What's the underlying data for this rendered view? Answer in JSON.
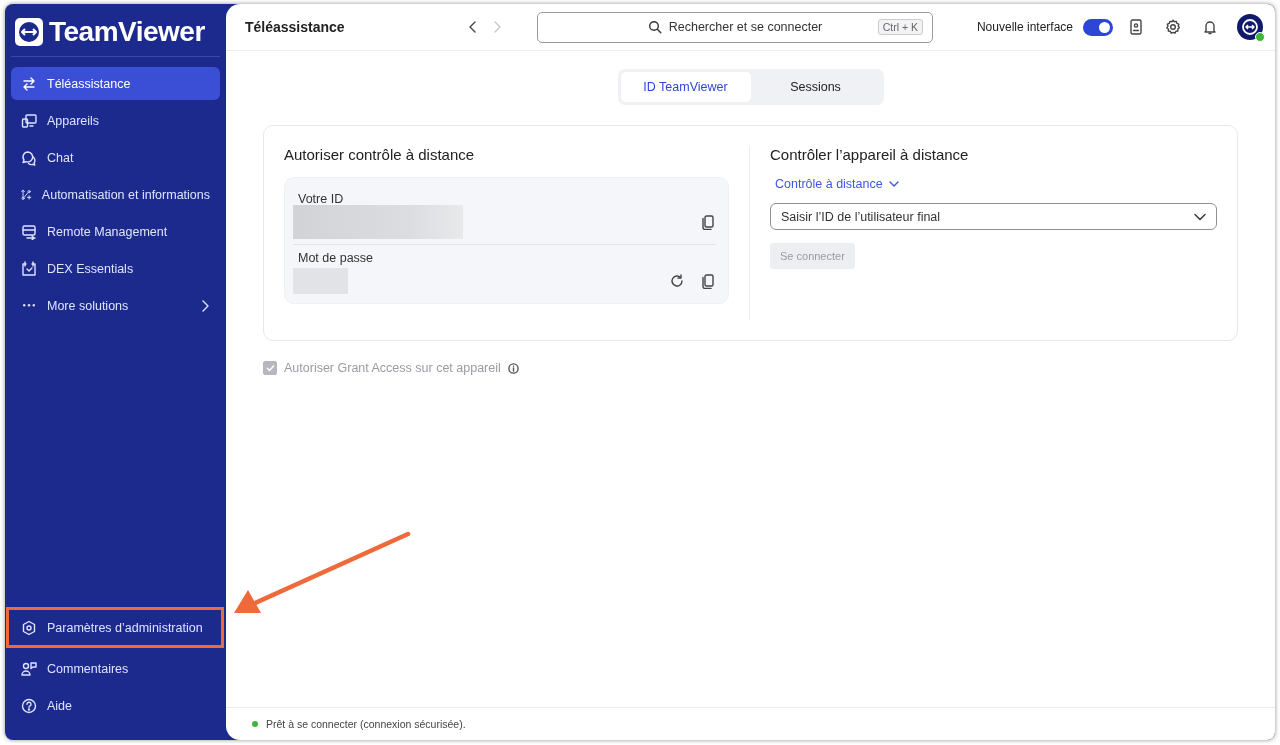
{
  "logo": {
    "text": "TeamViewer"
  },
  "sidebar": {
    "items": [
      {
        "label": "Téléassistance",
        "kind": "link",
        "selected": true
      },
      {
        "label": "Appareils",
        "kind": "link",
        "selected": false
      },
      {
        "label": "Chat",
        "kind": "link",
        "selected": false
      },
      {
        "label": "Automatisation et informations",
        "kind": "link",
        "selected": false
      },
      {
        "label": "Remote Management",
        "kind": "link",
        "selected": false
      },
      {
        "label": "DEX Essentials",
        "kind": "link",
        "selected": false
      },
      {
        "label": "More solutions",
        "kind": "submenu",
        "selected": false
      }
    ],
    "bottom_items": [
      {
        "label": "Paramètres d’administration",
        "highlighted": true
      },
      {
        "label": "Commentaires",
        "highlighted": false
      },
      {
        "label": "Aide",
        "highlighted": false
      }
    ]
  },
  "header": {
    "title": "Téléassistance",
    "nav_buttons": [
      {
        "disabled": false
      },
      {
        "disabled": true
      }
    ],
    "search": {
      "placeholder": "Rechercher et se connecter",
      "shortcut": "Ctrl + K"
    },
    "toggle": {
      "label": "Nouvelle interface",
      "on": true
    },
    "avatar": {
      "online": true
    }
  },
  "tabs": [
    {
      "label": "ID TeamViewer",
      "selected": true
    },
    {
      "label": "Sessions",
      "selected": false
    }
  ],
  "allow_panel": {
    "title": "Autoriser contrôle à distance",
    "fields": [
      {
        "label": "Votre ID",
        "kind": "id"
      },
      {
        "label": "Mot de passe",
        "kind": "password"
      }
    ]
  },
  "control_panel": {
    "title": "Contrôler l’appareil à distance",
    "mode": "Contrôle à distance",
    "id_field": {
      "placeholder": "Saisir l’ID de l’utilisateur final"
    },
    "connect_button": {
      "label": "Se connecter",
      "disabled": true
    }
  },
  "grant_access": {
    "label": "Autoriser Grant Access sur cet appareil",
    "checked": true,
    "disabled": true
  },
  "status_bar": {
    "text": "Prêt à se connecter (connexion sécurisée).",
    "ready": true
  }
}
